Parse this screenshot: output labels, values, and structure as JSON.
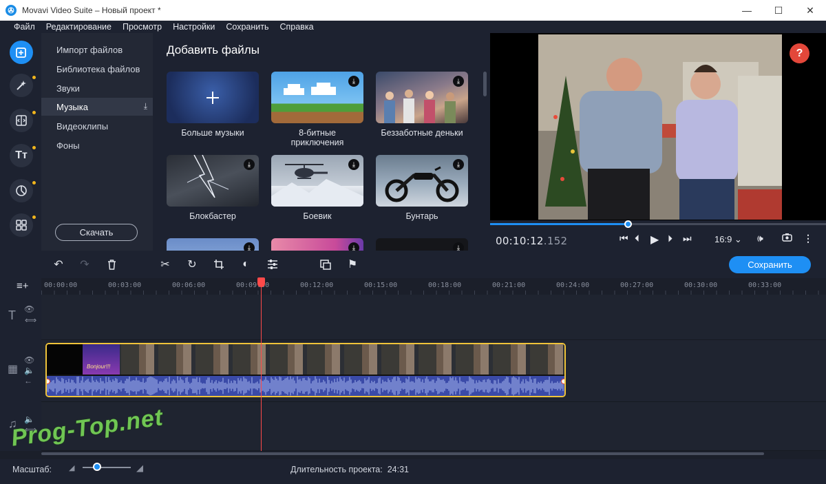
{
  "window": {
    "title": "Movavi Video Suite – Новый проект *",
    "minimize": "—",
    "maximize": "☐",
    "close": "✕"
  },
  "menu": [
    {
      "label": "Файл"
    },
    {
      "label": "Редактирование"
    },
    {
      "label": "Просмотр"
    },
    {
      "label": "Настройки"
    },
    {
      "label": "Сохранить"
    },
    {
      "label": "Справка"
    }
  ],
  "rail": [
    {
      "icon": "import-icon",
      "active": true
    },
    {
      "icon": "magic-wand-icon",
      "dot": true
    },
    {
      "icon": "transitions-icon",
      "dot": true
    },
    {
      "icon": "titles-icon",
      "dot": true
    },
    {
      "icon": "stickers-icon",
      "dot": true
    },
    {
      "icon": "more-tools-icon",
      "dot": true
    }
  ],
  "categories": {
    "items": [
      {
        "label": "Импорт файлов"
      },
      {
        "label": "Библиотека файлов"
      },
      {
        "label": "Звуки"
      },
      {
        "label": "Музыка",
        "active": true
      },
      {
        "label": "Видеоклипы"
      },
      {
        "label": "Фоны"
      }
    ],
    "download_label": "Скачать"
  },
  "library": {
    "title": "Добавить файлы",
    "tiles": [
      {
        "label": "Больше музыки",
        "kind": "more"
      },
      {
        "label": "8-битные приключения",
        "kind": "pixel"
      },
      {
        "label": "Беззаботные деньки",
        "kind": "party"
      },
      {
        "label": "Блокбастер",
        "kind": "lightning"
      },
      {
        "label": "Боевик",
        "kind": "heli"
      },
      {
        "label": "Бунтарь",
        "kind": "moto"
      }
    ]
  },
  "preview": {
    "help": "?",
    "timecode_main": "00:10:12",
    "timecode_ms": ".152",
    "progress": 0.41,
    "aspect": "16:9 ⌄"
  },
  "timeline": {
    "save_label": "Сохранить",
    "ruler": [
      "00:00:00",
      "00:03:00",
      "00:06:00",
      "00:09:00",
      "00:12:00",
      "00:15:00",
      "00:18:00",
      "00:21:00",
      "00:24:00",
      "00:27:00",
      "00:30:00",
      "00:33:00"
    ],
    "clip_title": "Bonjour!!!"
  },
  "status": {
    "scale_label": "Масштаб:",
    "duration_label": "Длительность проекта:",
    "duration_value": "24:31",
    "zoom": 0.3
  },
  "watermark": "Prog-Top.net",
  "colors": {
    "accent": "#1e8ff4",
    "clip_border": "#f0c43a",
    "playhead": "#ff4a4a",
    "help": "#e3473a"
  }
}
